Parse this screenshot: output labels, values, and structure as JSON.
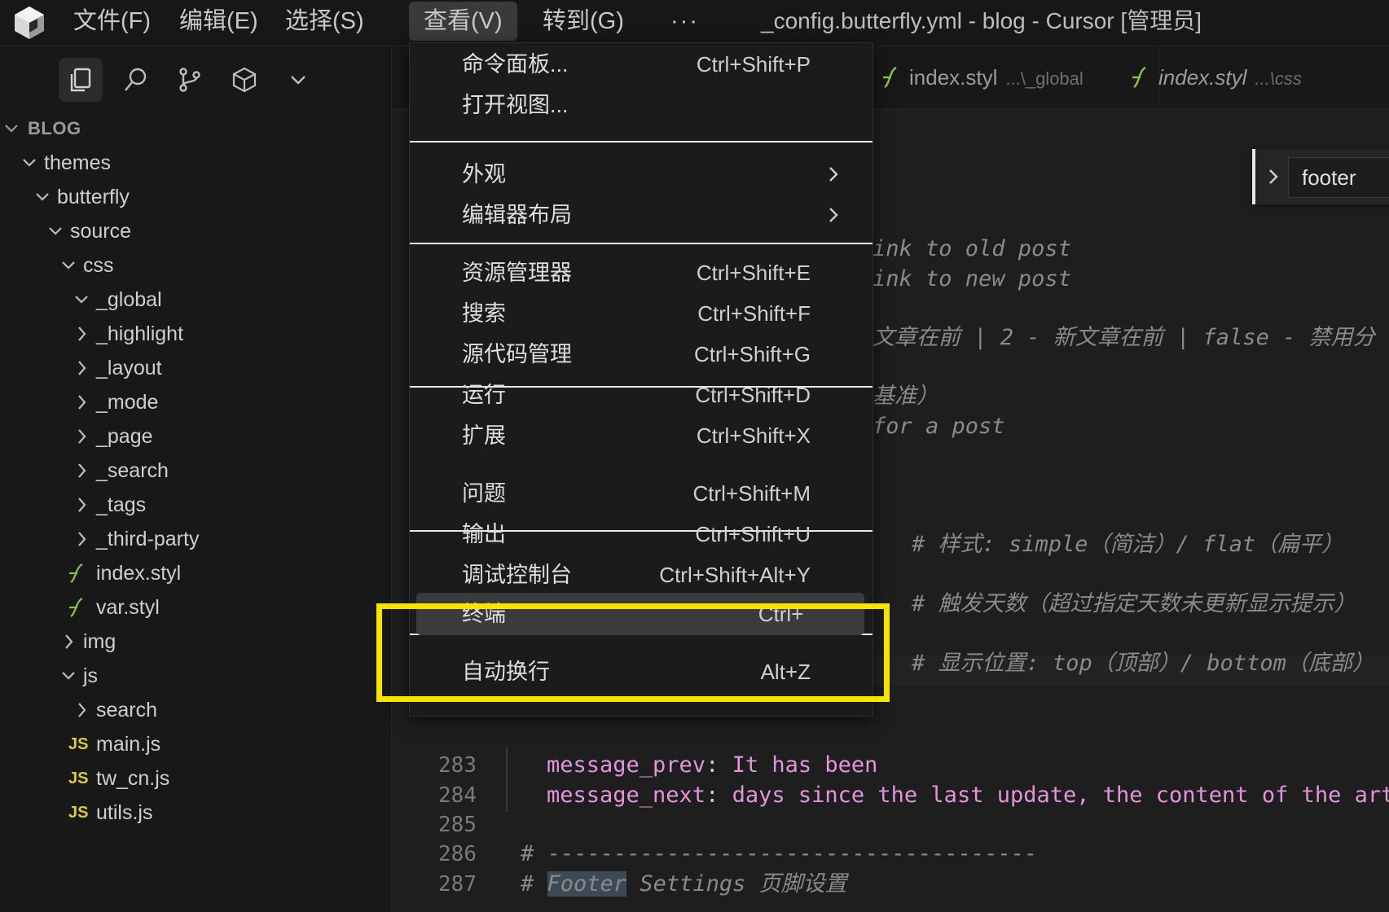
{
  "window": {
    "title": "_config.butterfly.yml - blog - Cursor [管理员]"
  },
  "menubar": {
    "items": [
      "文件(F)",
      "编辑(E)",
      "选择(S)",
      "查看(V)",
      "转到(G)"
    ],
    "active": "查看(V)",
    "more_label": "···"
  },
  "activity_icons": [
    "files-icon",
    "search-icon",
    "source-control-icon",
    "extensions-icon",
    "chevron-down-icon"
  ],
  "explorer": {
    "root": "BLOG",
    "tree": [
      {
        "label": "themes",
        "kind": "folder",
        "expanded": true,
        "depth": 1
      },
      {
        "label": "butterfly",
        "kind": "folder",
        "expanded": true,
        "depth": 2
      },
      {
        "label": "source",
        "kind": "folder",
        "expanded": true,
        "depth": 3
      },
      {
        "label": "css",
        "kind": "folder",
        "expanded": true,
        "depth": 4
      },
      {
        "label": "_global",
        "kind": "folder",
        "expanded": true,
        "depth": 5
      },
      {
        "label": "_highlight",
        "kind": "folder",
        "expanded": false,
        "depth": 5
      },
      {
        "label": "_layout",
        "kind": "folder",
        "expanded": false,
        "depth": 5
      },
      {
        "label": "_mode",
        "kind": "folder",
        "expanded": false,
        "depth": 5
      },
      {
        "label": "_page",
        "kind": "folder",
        "expanded": false,
        "depth": 5
      },
      {
        "label": "_search",
        "kind": "folder",
        "expanded": false,
        "depth": 5
      },
      {
        "label": "_tags",
        "kind": "folder",
        "expanded": false,
        "depth": 5
      },
      {
        "label": "_third-party",
        "kind": "folder",
        "expanded": false,
        "depth": 5
      },
      {
        "label": "index.styl",
        "kind": "styl",
        "depth": 5
      },
      {
        "label": "var.styl",
        "kind": "styl",
        "depth": 5
      },
      {
        "label": "img",
        "kind": "folder",
        "expanded": false,
        "depth": 4
      },
      {
        "label": "js",
        "kind": "folder",
        "expanded": true,
        "depth": 4
      },
      {
        "label": "search",
        "kind": "folder",
        "expanded": false,
        "depth": 5
      },
      {
        "label": "main.js",
        "kind": "js",
        "depth": 5
      },
      {
        "label": "tw_cn.js",
        "kind": "js",
        "depth": 5
      },
      {
        "label": "utils.js",
        "kind": "js",
        "depth": 5
      }
    ],
    "js_badge": "JS"
  },
  "tabs": [
    {
      "name": "index.styl",
      "path": "...\\_global"
    },
    {
      "name": "index.styl",
      "path": "...\\css"
    }
  ],
  "find_widget": {
    "value": "footer"
  },
  "code": {
    "partial_lines": [
      {
        "text": "ink to old post",
        "type": "comment"
      },
      {
        "text": "ink to new post",
        "type": "comment"
      },
      {
        "text": "文章在前 | 2 - 新文章在前 | false - 禁用分",
        "type": "comment"
      },
      {
        "text": "基准）",
        "type": "comment"
      },
      {
        "text": "for a post",
        "type": "comment"
      },
      {
        "text": "# 样式: simple（简洁）/ flat（扁平）",
        "type": "comment"
      },
      {
        "text": "# 触发天数（超过指定天数未更新显示提示）",
        "type": "comment"
      },
      {
        "text": "# 显示位置: top（顶部）/ bottom（底部）",
        "type": "comment"
      }
    ],
    "lines": [
      {
        "number": "283",
        "key": "message_prev",
        "colon": ":",
        "value": " It has been"
      },
      {
        "number": "284",
        "key": "message_next",
        "colon": ":",
        "value": " days since the last update, the content of the arti"
      },
      {
        "number": "285",
        "text": ""
      },
      {
        "number": "286",
        "text": "# -------------------------------------"
      },
      {
        "number": "287",
        "prefix": "# ",
        "highlight": "Footer",
        "rest": " Settings 页脚设置"
      }
    ]
  },
  "view_menu": {
    "groups": [
      [
        {
          "label": "命令面板...",
          "shortcut": "Ctrl+Shift+P"
        },
        {
          "label": "打开视图...",
          "shortcut": ""
        }
      ],
      [
        {
          "label": "外观",
          "submenu": true
        },
        {
          "label": "编辑器布局",
          "submenu": true
        }
      ],
      [
        {
          "label": "资源管理器",
          "shortcut": "Ctrl+Shift+E"
        },
        {
          "label": "搜索",
          "shortcut": "Ctrl+Shift+F"
        },
        {
          "label": "源代码管理",
          "shortcut": "Ctrl+Shift+G"
        },
        {
          "label": "运行",
          "shortcut": "Ctrl+Shift+D"
        },
        {
          "label": "扩展",
          "shortcut": "Ctrl+Shift+X"
        }
      ],
      [
        {
          "label": "问题",
          "shortcut": "Ctrl+Shift+M"
        },
        {
          "label": "输出",
          "shortcut": "Ctrl+Shift+U"
        },
        {
          "label": "调试控制台",
          "shortcut": "Ctrl+Shift+Alt+Y"
        },
        {
          "label": "终端",
          "shortcut": "Ctrl+`",
          "highlighted": true
        }
      ],
      [
        {
          "label": "自动换行",
          "shortcut": "Alt+Z"
        }
      ]
    ]
  },
  "colors": {
    "annotation": "#f5e400",
    "yaml_key": "#e394dc",
    "comment": "#8a8a8a",
    "js_badge": "#d9c84a",
    "styl_icon": "#8bc34a"
  }
}
